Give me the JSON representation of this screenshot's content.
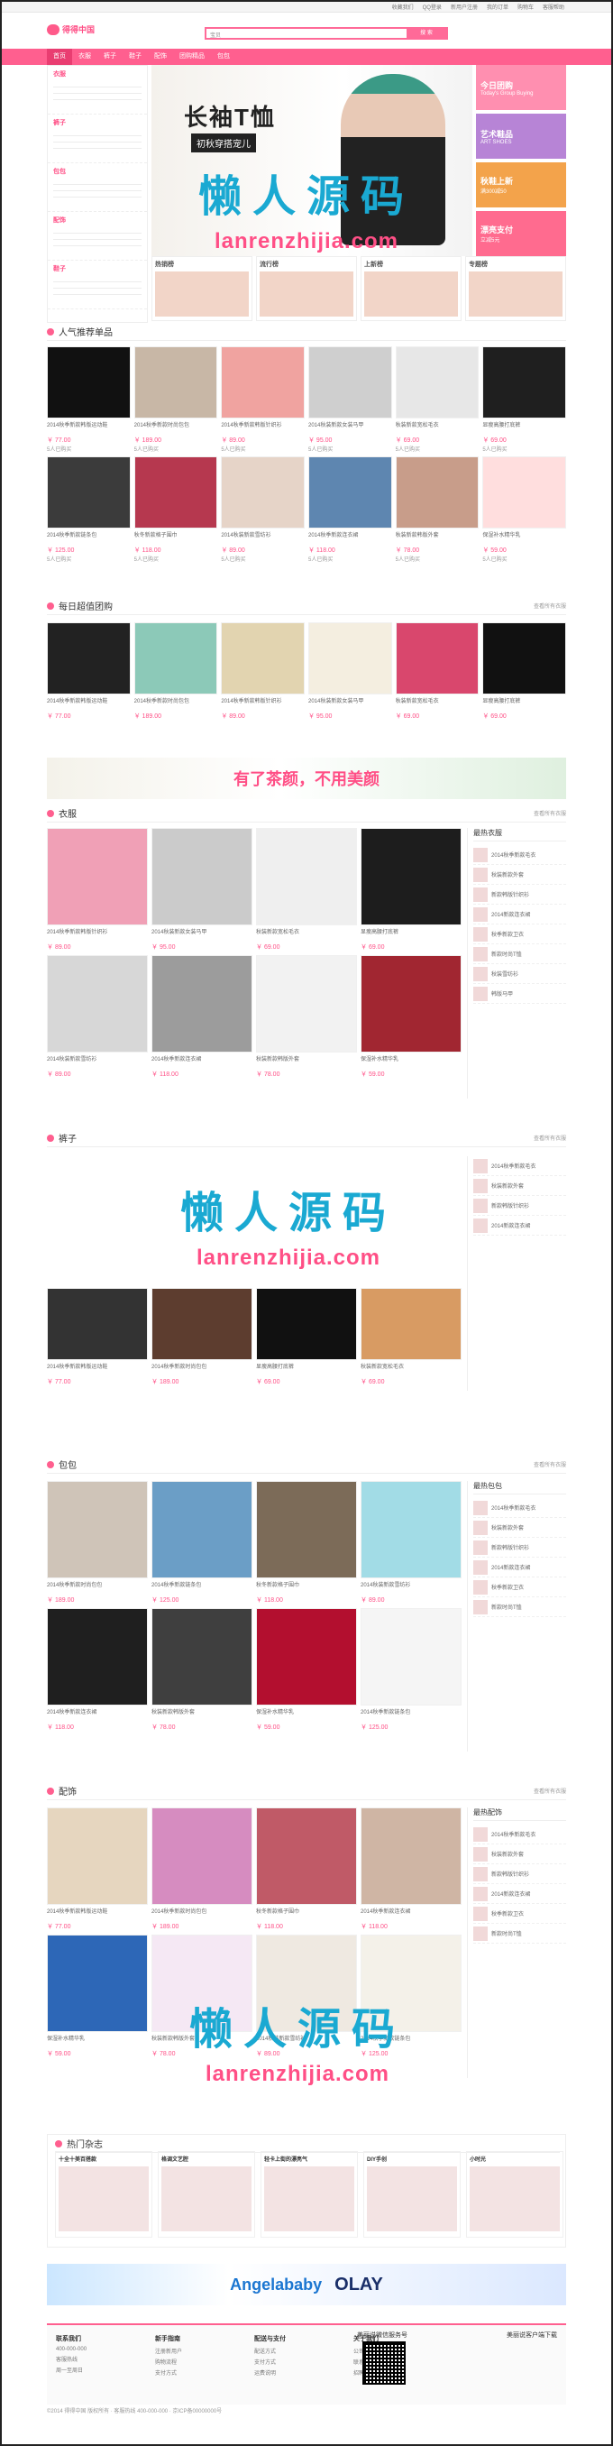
{
  "header": {
    "logo": "得得中国",
    "search_placeholder": "宝贝",
    "search_button": "搜 索",
    "top_links": [
      "收藏我们",
      "QQ登录",
      "新用户注册",
      "我的订单",
      "购物车",
      "客服帮助"
    ]
  },
  "nav": [
    "首页",
    "衣服",
    "裤子",
    "鞋子",
    "配饰",
    "团购精品",
    "包包"
  ],
  "categories": [
    {
      "title": "衣服"
    },
    {
      "title": "裤子"
    },
    {
      "title": "包包"
    },
    {
      "title": "配饰"
    },
    {
      "title": "鞋子"
    }
  ],
  "banner": {
    "title": "长袖T恤",
    "subtitle": "初秋穿搭宠儿"
  },
  "ads": [
    {
      "title": "今日团购",
      "sub": "Today's Group Buying",
      "color": "#ff8fb0"
    },
    {
      "title": "艺术鞋品",
      "sub": "ART SHOES",
      "color": "#b784d6"
    },
    {
      "title": "秋鞋上新",
      "sub": "满300减50",
      "color": "#f3a34b"
    },
    {
      "title": "漂亮支付",
      "sub": "立减5元",
      "color": "#ff6b8f"
    }
  ],
  "small_cards": [
    "热销榜",
    "流行榜",
    "上新榜",
    "专题榜"
  ],
  "sections": {
    "popular": "人气推荐单品",
    "daily": "每日超值团购",
    "clothes": "衣服",
    "pants": "裤子",
    "bags": "包包",
    "accessories": "配饰",
    "hot": "热门杂志",
    "more": "查看所有衣服"
  },
  "products": [
    {
      "name": "2014秋季新款韩版运动鞋",
      "price": "￥ 77.00",
      "sold": "5人已购买"
    },
    {
      "name": "2014秋季新款时尚包包",
      "price": "￥ 189.00",
      "sold": "5人已购买"
    },
    {
      "name": "2014秋季新款韩版针织衫",
      "price": "￥ 89.00",
      "sold": "5人已购买"
    },
    {
      "name": "2014秋装新款女装马甲",
      "price": "￥ 95.00",
      "sold": "5人已购买"
    },
    {
      "name": "秋装新款宽松毛衣",
      "price": "￥ 69.00",
      "sold": "5人已购买"
    },
    {
      "name": "显瘦高腰打底裤",
      "price": "￥ 69.00",
      "sold": "5人已购买"
    },
    {
      "name": "2014秋季新款链条包",
      "price": "￥ 125.00",
      "sold": "5人已购买"
    },
    {
      "name": "秋冬新款格子围巾",
      "price": "￥ 118.00",
      "sold": "5人已购买"
    },
    {
      "name": "2014秋装新款雪纺衫",
      "price": "￥ 89.00",
      "sold": "5人已购买"
    },
    {
      "name": "2014秋季新款连衣裙",
      "price": "￥ 118.00",
      "sold": "5人已购买"
    },
    {
      "name": "秋装新款韩版外套",
      "price": "￥ 78.00",
      "sold": "5人已购买"
    },
    {
      "name": "保湿补水精华乳",
      "price": "￥ 59.00",
      "sold": "5人已购买"
    }
  ],
  "promo": "有了茶颜，不用美颜",
  "water": {
    "cn": "懒人源码",
    "en": "lanrenzhijia.com"
  },
  "right_list": {
    "clothes_title": "最热衣服",
    "bags_title": "最热包包",
    "acc_title": "最热配饰",
    "items": [
      "2014秋季新款毛衣",
      "秋装新款外套",
      "新款韩版针织衫",
      "2014新款连衣裙",
      "秋季新款卫衣",
      "新款时尚T恤",
      "秋装雪纺衫",
      "韩版马甲"
    ]
  },
  "hot": [
    "十全十美百搭款",
    "格调文艺腔",
    "轻卡上街的漂亮气",
    "DIY手创",
    "小时光"
  ],
  "bottom_banner": {
    "brand": "Angelababy",
    "text": "OLAY"
  },
  "footer": {
    "cols": [
      {
        "title": "联系我们",
        "items": [
          "400-000-000",
          "客服热线",
          "周一至周日"
        ]
      },
      {
        "title": "新手指南",
        "items": [
          "注册新用户",
          "购物流程",
          "支付方式"
        ]
      },
      {
        "title": "配送与支付",
        "items": [
          "配送方式",
          "支付方式",
          "运费说明"
        ]
      },
      {
        "title": "关于我们",
        "items": [
          "公司简介",
          "联系我们",
          "招聘信息"
        ]
      }
    ],
    "qr_title": "美丽说微信服务号",
    "app_title": "美丽说客户端下载",
    "copyright": "©2014 得得中国 版权所有 · 客服热线 400-000-000 · 京ICP备00000000号"
  }
}
